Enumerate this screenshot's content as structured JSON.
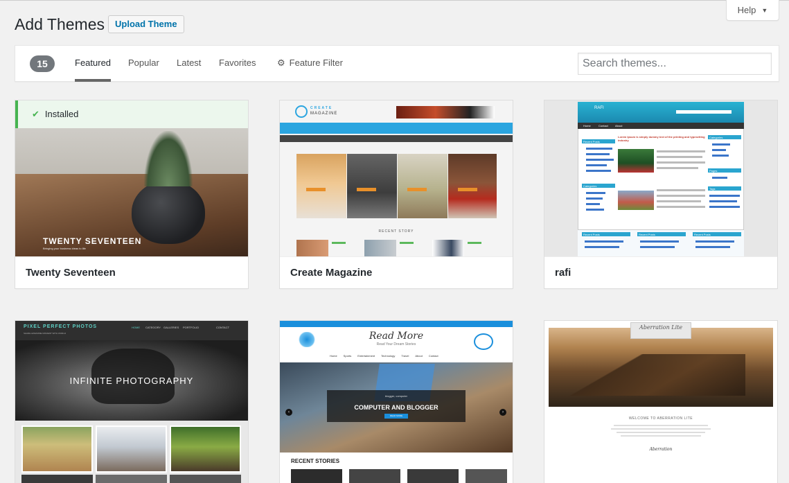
{
  "help": {
    "label": "Help",
    "caret": "▼"
  },
  "header": {
    "title": "Add Themes",
    "upload_label": "Upload Theme"
  },
  "filter": {
    "count": "15",
    "tabs": [
      "Featured",
      "Popular",
      "Latest",
      "Favorites"
    ],
    "feature_filter_label": "Feature Filter",
    "search_placeholder": "Search themes..."
  },
  "themes": [
    {
      "name": "Twenty Seventeen",
      "installed_label": "Installed",
      "hero_title": "TWENTY SEVENTEEN",
      "hero_sub": "Bringing your business ideas to life"
    },
    {
      "name": "Create Magazine",
      "logo_top": "CREATE",
      "logo_bottom": "MAGAZINE",
      "section_label": "RECENT STORY"
    },
    {
      "name": "rafi",
      "site_title": "RAFI",
      "nav": [
        "Home",
        "Contact",
        "About"
      ],
      "left_heading": "Recent Posts",
      "left_heading2": "Categories",
      "right_heading": "Categories",
      "right_heading2": "Pages",
      "right_heading3": "Tags",
      "post_title": "Lorem Ipsum is simply dummy text of the printing and typesetting industry",
      "footer_headings": [
        "Recent Posts",
        "Recent Posts",
        "Recent Posts"
      ]
    },
    {
      "brand": "PIXEL PERFECT PHOTOS",
      "tagline": "SHARE AWESOME MOMENT WITH WORLD",
      "hero_title": "INFINITE PHOTOGRAPHY",
      "nav": [
        "HOME",
        "CATEGORY",
        "GALLERIES",
        "PORTFOLIO",
        "CONTACT"
      ]
    },
    {
      "logo_text": "Read More",
      "logo_sub": "Read Your Dream Stories",
      "nav": [
        "Home",
        "Sports",
        "Entertainment",
        "Technology",
        "Travel",
        "About",
        "Contact"
      ],
      "slide_category": "blogger, computer",
      "slide_title": "COMPUTER AND BLOGGER",
      "slide_button": "READ MORE",
      "section_label": "RECENT STORIES"
    },
    {
      "logo_text": "Aberration Lite",
      "welcome": "WELCOME TO ABERRATION LITE",
      "signature": "Aberration"
    }
  ],
  "colors": {
    "accent_blue": "#0073aa",
    "installed_green": "#46b450",
    "magazine_blue": "#2ba5e0",
    "readmore_blue": "#1a8fdc"
  }
}
